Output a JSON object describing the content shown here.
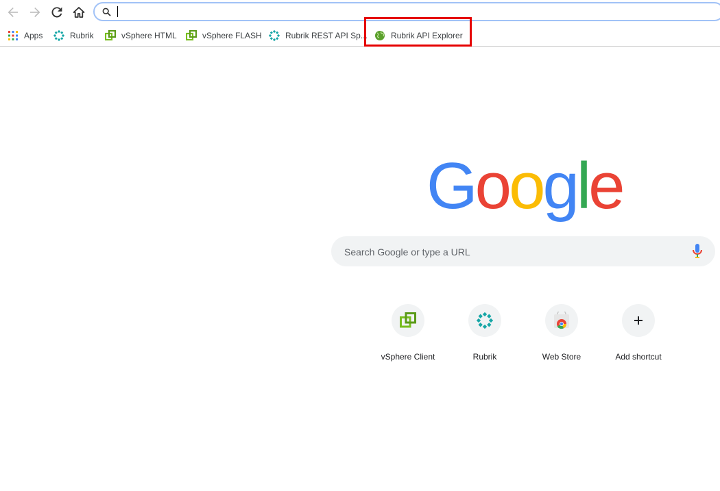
{
  "omnibox": {
    "value": "",
    "placeholder": ""
  },
  "bookmarks": [
    {
      "label": "Apps",
      "icon": "apps-grid-icon"
    },
    {
      "label": "Rubrik",
      "icon": "rubrik-icon"
    },
    {
      "label": "vSphere HTML",
      "icon": "vsphere-icon"
    },
    {
      "label": "vSphere FLASH",
      "icon": "vsphere-icon"
    },
    {
      "label": "Rubrik REST API Sp...",
      "icon": "rubrik-icon"
    },
    {
      "label": "Rubrik API Explorer",
      "icon": "globe-icon"
    }
  ],
  "logo": {
    "letters": [
      "G",
      "o",
      "o",
      "g",
      "l",
      "e"
    ],
    "colors": [
      "#4285f4",
      "#ea4335",
      "#fbbc05",
      "#4285f4",
      "#34a853",
      "#ea4335"
    ]
  },
  "search": {
    "placeholder": "Search Google or type a URL"
  },
  "shortcuts": [
    {
      "label": "vSphere Client",
      "icon": "vsphere-icon"
    },
    {
      "label": "Rubrik",
      "icon": "rubrik-icon"
    },
    {
      "label": "Web Store",
      "icon": "chrome-web-store-icon"
    },
    {
      "label": "Add shortcut",
      "icon": "plus-icon"
    }
  ],
  "colors": {
    "highlight": "#e50000",
    "omnibox_border": "#a1c2f7",
    "rubrik_teal": "#16a6a6",
    "vsphere_green": "#78be20"
  }
}
